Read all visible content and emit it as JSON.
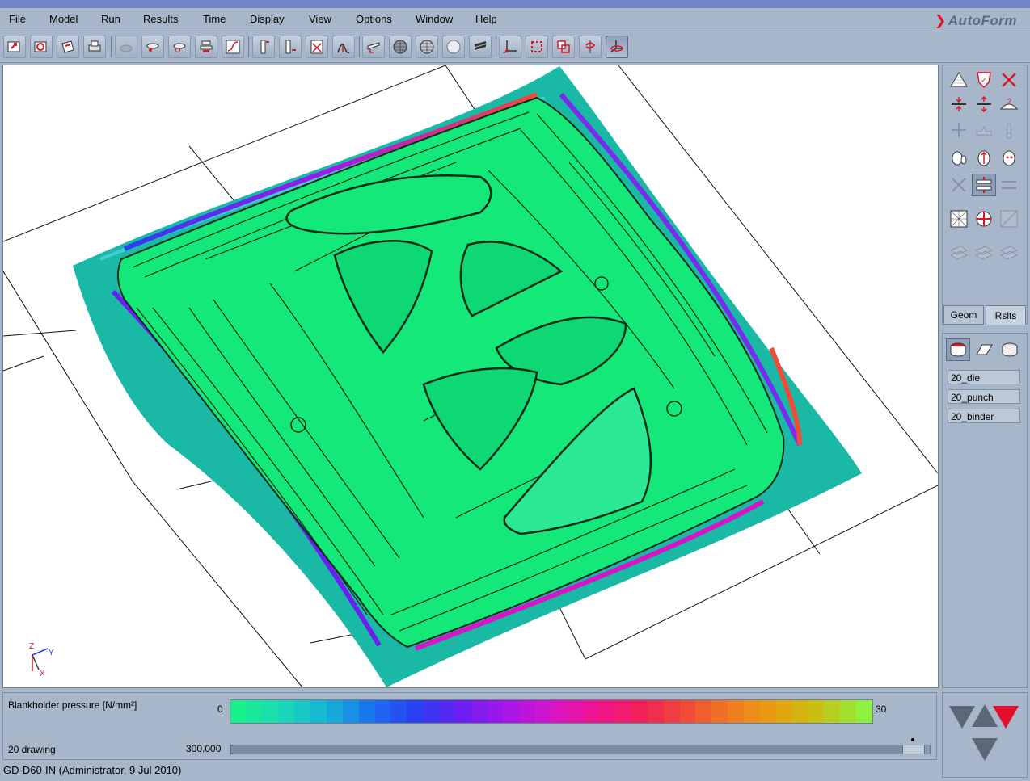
{
  "menu": {
    "items": [
      "File",
      "Model",
      "Run",
      "Results",
      "Time",
      "Display",
      "View",
      "Options",
      "Window",
      "Help"
    ],
    "brand": "AutoForm"
  },
  "toolbar": {
    "groups": [
      [
        "open-file-icon",
        "save-file-icon",
        "print-preview-icon",
        "printer-icon"
      ],
      [
        "tool-disabled-icon",
        "tool-cap-icon",
        "tool-drawbead-icon",
        "tool-stack-icon",
        "curve-graph-icon"
      ],
      [
        "ruler-icon",
        "section-ruler-icon",
        "chart-icon",
        "flc-icon"
      ],
      [
        "shading-icon",
        "wireframe-sphere-icon",
        "mesh-sphere-icon",
        "solid-sphere-icon",
        "layers-icon"
      ],
      [
        "axes-icon",
        "zoom-fit-icon",
        "zoom-box-icon",
        "rotate-icon",
        "view-3d-icon"
      ]
    ]
  },
  "right_panel": {
    "tabs": [
      "Geom",
      "Rslts"
    ],
    "active_tab": "Rslts"
  },
  "tools_panel": {
    "items": [
      "20_die",
      "20_punch",
      "20_binder"
    ]
  },
  "legend": {
    "title": "Blankholder pressure [N/mm²]",
    "min_label": "0",
    "max_label": "30",
    "colors": [
      "#18f08a",
      "#19d8b8",
      "#17b4d8",
      "#1b6ff0",
      "#2a3ef2",
      "#6b1ff0",
      "#a516e8",
      "#d614c8",
      "#f01490",
      "#f0215a",
      "#f04a38",
      "#f07a20",
      "#e8a010",
      "#c8c010",
      "#8ef040"
    ]
  },
  "animation": {
    "stage_label": "20 drawing",
    "time_value": "300.000",
    "progress_fraction": 0.99
  },
  "status": {
    "text": "GD-D60-IN (Administrator,  9 Jul 2010)"
  },
  "viewport": {
    "axis_labels": {
      "z": "Z",
      "y": "Y",
      "x": "X"
    },
    "part_color": "#13e879",
    "binder_color": "#1ab9a5"
  }
}
